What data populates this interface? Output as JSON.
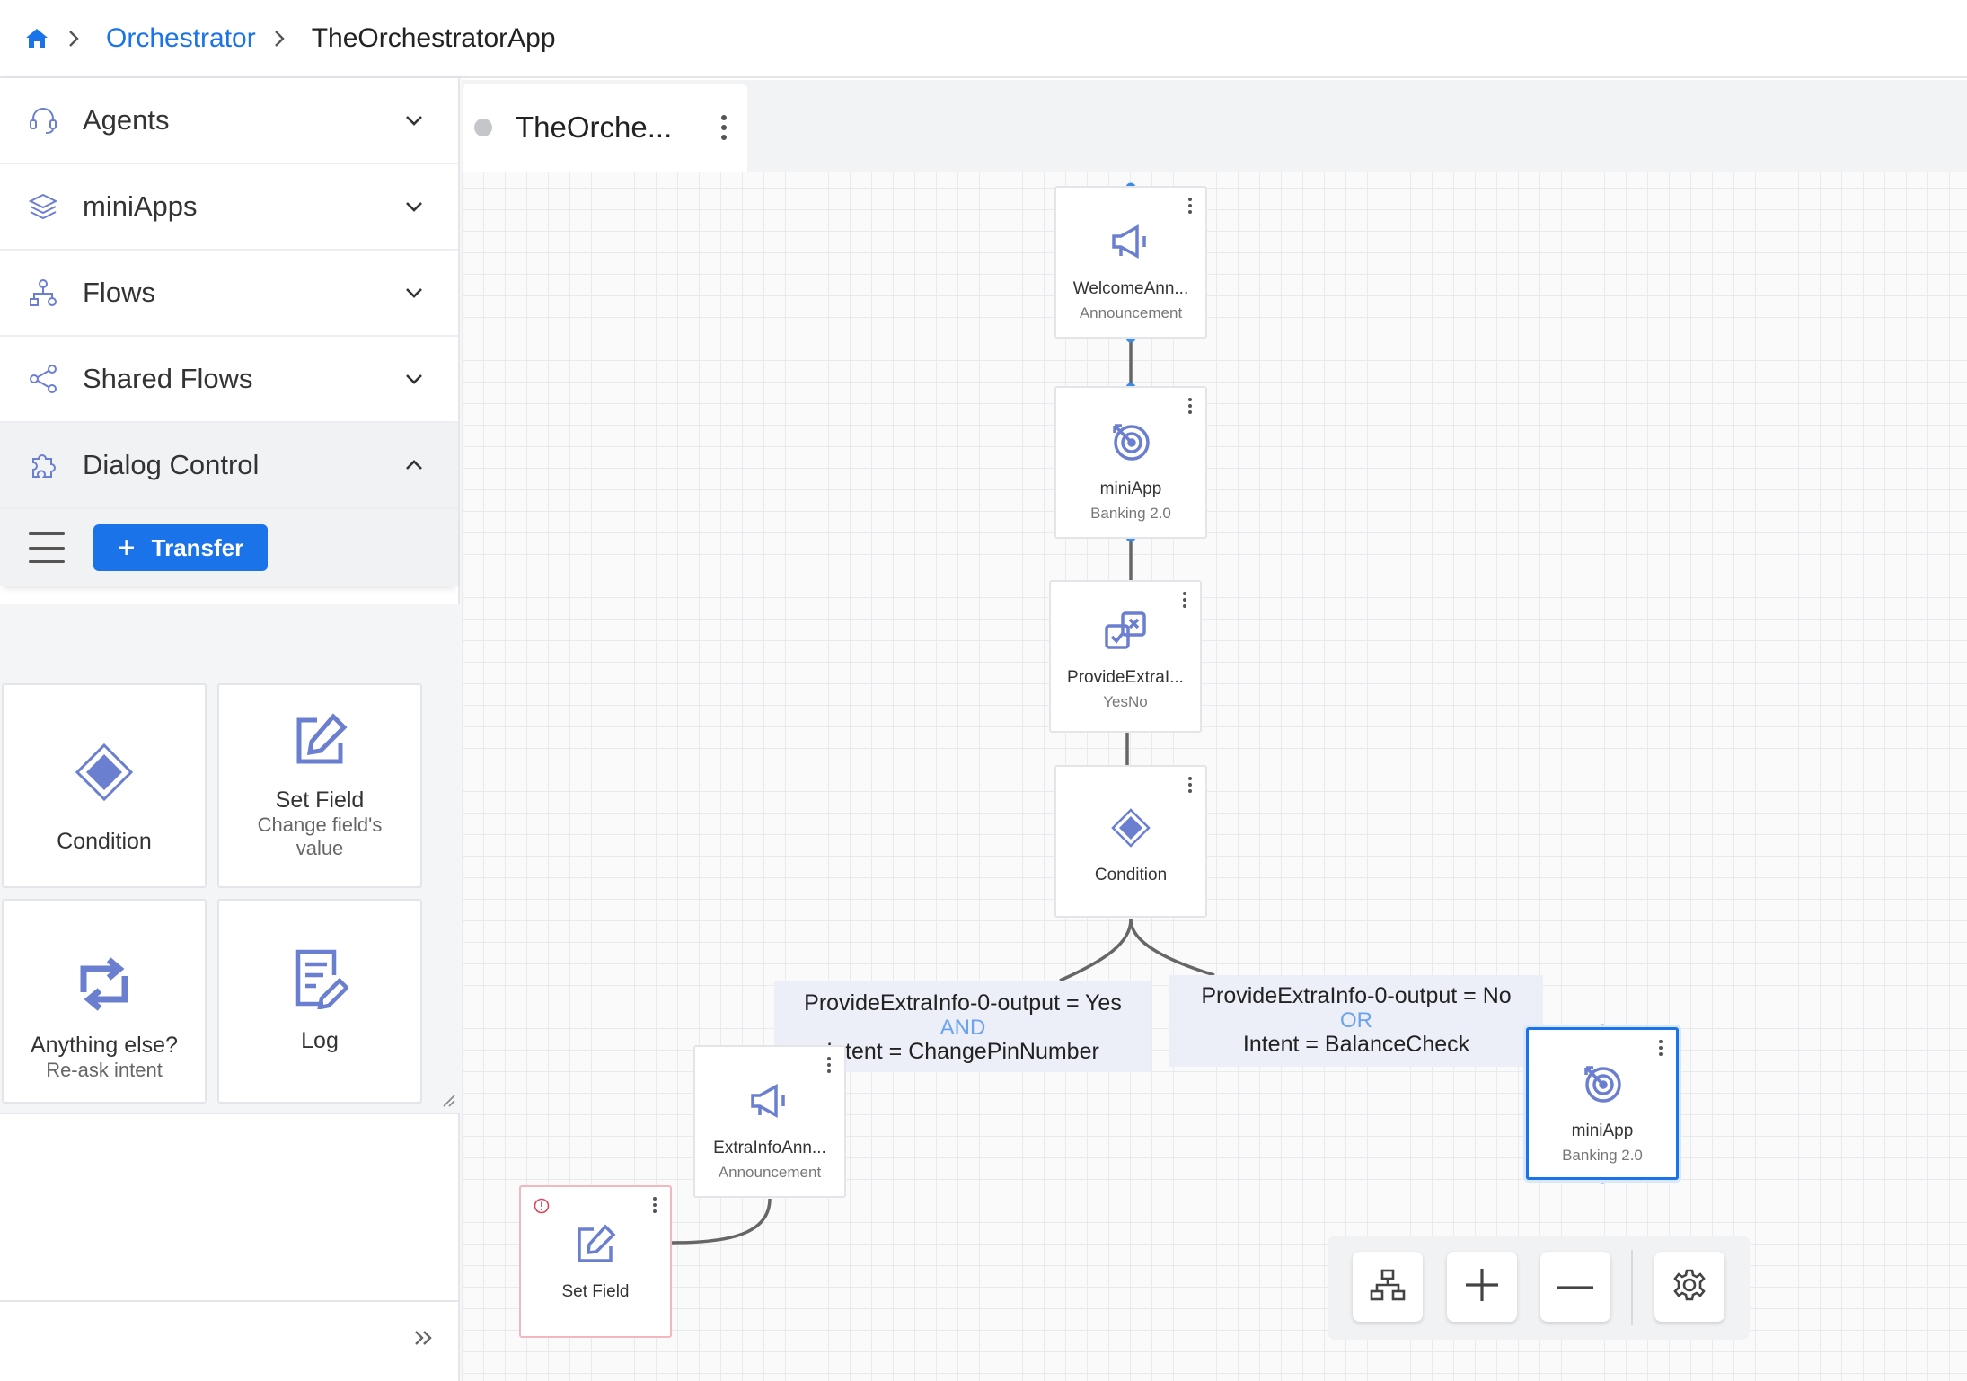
{
  "breadcrumb": {
    "home_icon": "home-icon",
    "items": [
      "Orchestrator",
      "TheOrchestratorApp"
    ]
  },
  "sidebar": {
    "sections": [
      {
        "label": "Agents",
        "icon": "headset-icon",
        "state": "collapsed"
      },
      {
        "label": "miniApps",
        "icon": "layers-icon",
        "state": "collapsed"
      },
      {
        "label": "Flows",
        "icon": "flow-tree-icon",
        "state": "collapsed"
      },
      {
        "label": "Shared Flows",
        "icon": "share-icon",
        "state": "collapsed"
      },
      {
        "label": "Dialog Control",
        "icon": "puzzle-icon",
        "state": "expanded"
      }
    ],
    "transfer_label": "Transfer",
    "tiles": [
      {
        "title": "Condition",
        "subtitle": "",
        "icon": "diamond-icon"
      },
      {
        "title": "Set Field",
        "subtitle": "Change field's value",
        "icon": "edit-icon"
      },
      {
        "title": "Anything else?",
        "subtitle": "Re-ask intent",
        "icon": "repeat-icon"
      },
      {
        "title": "Log",
        "subtitle": "",
        "icon": "log-icon"
      }
    ]
  },
  "flow_tab": {
    "name": "TheOrche..."
  },
  "nodes": {
    "welcome": {
      "title": "WelcomeAnn...",
      "type": "Announcement"
    },
    "miniapp1": {
      "title": "miniApp",
      "type": "Banking 2.0"
    },
    "provide": {
      "title": "ProvideExtraI...",
      "type": "YesNo"
    },
    "condition": {
      "title": "Condition",
      "type": ""
    },
    "extrainfo": {
      "title": "ExtraInfoAnn...",
      "type": "Announcement"
    },
    "setfield": {
      "title": "Set Field",
      "type": ""
    },
    "miniapp2": {
      "title": "miniApp",
      "type": "Banking 2.0"
    }
  },
  "conditions": {
    "left": {
      "line1": "ProvideExtraInfo-0-output = Yes",
      "op": "AND",
      "line2": "Intent = ChangePinNumber"
    },
    "right": {
      "line1": "ProvideExtraInfo-0-output = No",
      "op": "OR",
      "line2": "Intent = BalanceCheck"
    }
  },
  "colors": {
    "accent": "#1a73e8",
    "icon": "#6b7fd1",
    "error": "#e0435a"
  }
}
